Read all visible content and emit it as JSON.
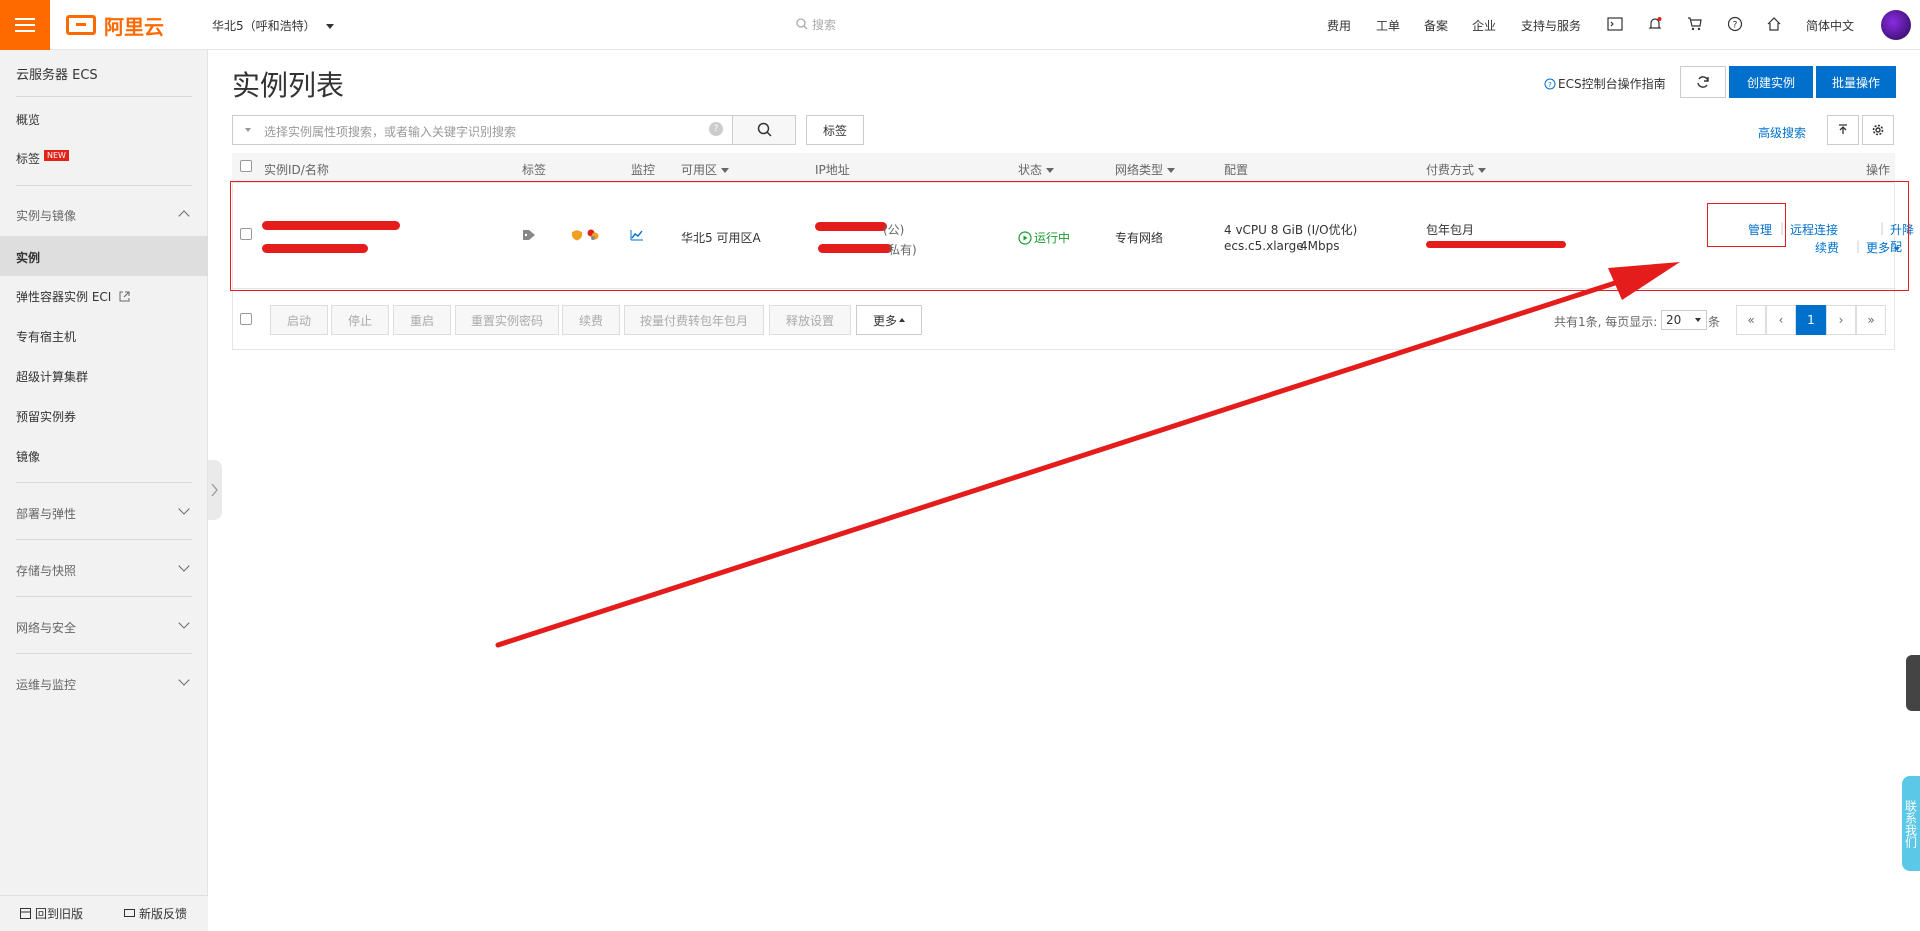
{
  "topbar": {
    "brand": "阿里云",
    "region": "华北5（呼和浩特）",
    "search_placeholder": "搜索",
    "nav": [
      "费用",
      "工单",
      "备案",
      "企业",
      "支持与服务"
    ],
    "language": "简体中文"
  },
  "sidebar": {
    "title": "云服务器 ECS",
    "overview": "概览",
    "tags": "标签",
    "new_badge": "NEW",
    "group_instances": "实例与镜像",
    "items": [
      "实例",
      "弹性容器实例 ECI",
      "专有宿主机",
      "超级计算集群",
      "预留实例券",
      "镜像"
    ],
    "groups": [
      "部署与弹性",
      "存储与快照",
      "网络与安全",
      "运维与监控"
    ],
    "footer_old": "回到旧版",
    "footer_feedback": "新版反馈"
  },
  "main": {
    "title": "实例列表",
    "help_link": "ECS控制台操作指南",
    "create_button": "创建实例",
    "batch_button": "批量操作",
    "search_placeholder": "选择实例属性项搜索，或者输入关键字识别搜索",
    "tag_button": "标签",
    "advanced_search": "高级搜索",
    "columns": [
      "实例ID/名称",
      "标签",
      "监控",
      "可用区",
      "IP地址",
      "状态",
      "网络类型",
      "配置",
      "付费方式",
      "操作"
    ],
    "row": {
      "zone": "华北5 可用区A",
      "ip_public_suffix": "(公)",
      "ip_private_suffix": "私有)",
      "status": "运行中",
      "network": "专有网络",
      "config_line1": "4 vCPU 8 GiB (I/O优化)",
      "config_line2": "ecs.c5.xlarge",
      "bandwidth": "4Mbps",
      "billing": "包年包月",
      "actions": {
        "manage": "管理",
        "remote": "远程连接",
        "upgrade": "升降配",
        "renew": "续费",
        "more": "更多"
      }
    },
    "bottom_actions": [
      "启动",
      "停止",
      "重启",
      "重置实例密码",
      "续费",
      "按量付费转包年包月",
      "释放设置"
    ],
    "bottom_more": "更多",
    "pagination": {
      "summary": "共有1条, 每页显示:",
      "page_size": "20",
      "unit": "条",
      "first": "«",
      "prev": "‹",
      "current": "1",
      "next": "›",
      "last": "»"
    }
  },
  "contact_widget": "联系我们",
  "colors": {
    "accent": "#ff6a00",
    "primary": "#0070cc",
    "annotation": "#e51c1c",
    "running": "#1a9b2e"
  }
}
